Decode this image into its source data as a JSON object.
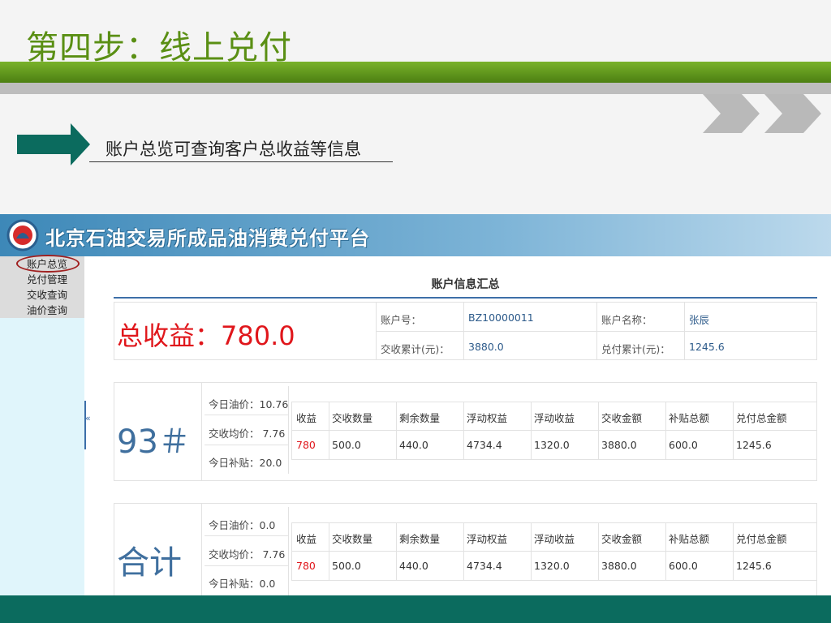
{
  "slide": {
    "title": "第四步：线上兑付",
    "subtitle": "账户总览可查询客户总收益等信息"
  },
  "app": {
    "title": "北京石油交易所成品油消费兑付平台",
    "nav": [
      "账户总览",
      "兑付管理",
      "交收查询",
      "油价查询"
    ],
    "collapse_glyph": "«"
  },
  "summary": {
    "title": "账户信息汇总",
    "total_income": "总收益：780.0",
    "account_no_label": "账户号：",
    "account_no": "BZ10000011",
    "account_name_label": "账户名称：",
    "account_name": "张辰",
    "delivered_label": "交收累计(元)：",
    "delivered": "3880.0",
    "paid_label": "兑付累计(元)：",
    "paid": "1245.6"
  },
  "columns": [
    "收益",
    "交收数量",
    "剩余数量",
    "浮动权益",
    "浮动收益",
    "交收金额",
    "补贴总额",
    "兑付总金额"
  ],
  "panels": [
    {
      "grade": "93＃",
      "oil_price": "今日油价：10.76",
      "avg_price": "交收均价： 7.76",
      "subsidy": "今日补贴：20.0",
      "row": [
        "780",
        "500.0",
        "440.0",
        "4734.4",
        "1320.0",
        "3880.0",
        "600.0",
        "1245.6"
      ]
    },
    {
      "grade": "合计",
      "oil_price": "今日油价：0.0",
      "avg_price": "交收均价： 7.76",
      "subsidy": "今日补贴：0.0",
      "row": [
        "780",
        "500.0",
        "440.0",
        "4734.4",
        "1320.0",
        "3880.0",
        "600.0",
        "1245.6"
      ]
    }
  ],
  "colors": {
    "title_green": "#5a8f14",
    "accent_blue": "#3d6fa8",
    "income_red": "#e0161b",
    "footer_teal": "#0b6b5e"
  }
}
